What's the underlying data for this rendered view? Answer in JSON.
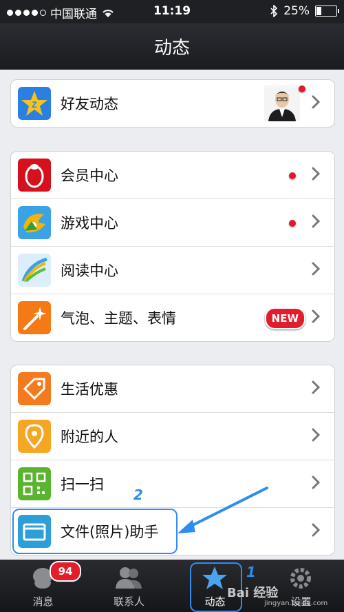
{
  "status_bar": {
    "carrier": "中国联通",
    "time": "11:19",
    "battery": "25%",
    "battery_level": 0.25
  },
  "nav": {
    "title": "动态"
  },
  "groups": [
    {
      "items": [
        {
          "label": "好友动态",
          "icon": "qzone-star-icon",
          "has_avatar": true,
          "has_dot": true
        }
      ]
    },
    {
      "items": [
        {
          "label": "会员中心",
          "icon": "vip-penguin-icon",
          "has_dot": true
        },
        {
          "label": "游戏中心",
          "icon": "game-center-icon",
          "has_dot": true
        },
        {
          "label": "阅读中心",
          "icon": "reading-icon"
        },
        {
          "label": "气泡、主题、表情",
          "icon": "magic-wand-icon",
          "badge": "NEW"
        }
      ]
    },
    {
      "items": [
        {
          "label": "生活优惠",
          "icon": "tag-icon"
        },
        {
          "label": "附近的人",
          "icon": "location-pin-icon"
        },
        {
          "label": "扫一扫",
          "icon": "qr-code-icon"
        },
        {
          "label": "文件(照片)助手",
          "icon": "folder-icon"
        }
      ]
    }
  ],
  "annotations": {
    "step1": "1",
    "step2": "2"
  },
  "tabs": [
    {
      "label": "消息",
      "icon": "chat-bubble-icon",
      "badge": "94"
    },
    {
      "label": "联系人",
      "icon": "contacts-icon"
    },
    {
      "label": "动态",
      "icon": "star-icon",
      "active": true
    },
    {
      "label": "设置",
      "icon": "gear-icon"
    }
  ],
  "watermark": {
    "text": "Bai 经验",
    "sub": "jingyan.baidu.com"
  },
  "colors": {
    "accent": "#2f8cf0",
    "badge_red": "#e41d2d",
    "nav_bg": "#1f2024"
  }
}
